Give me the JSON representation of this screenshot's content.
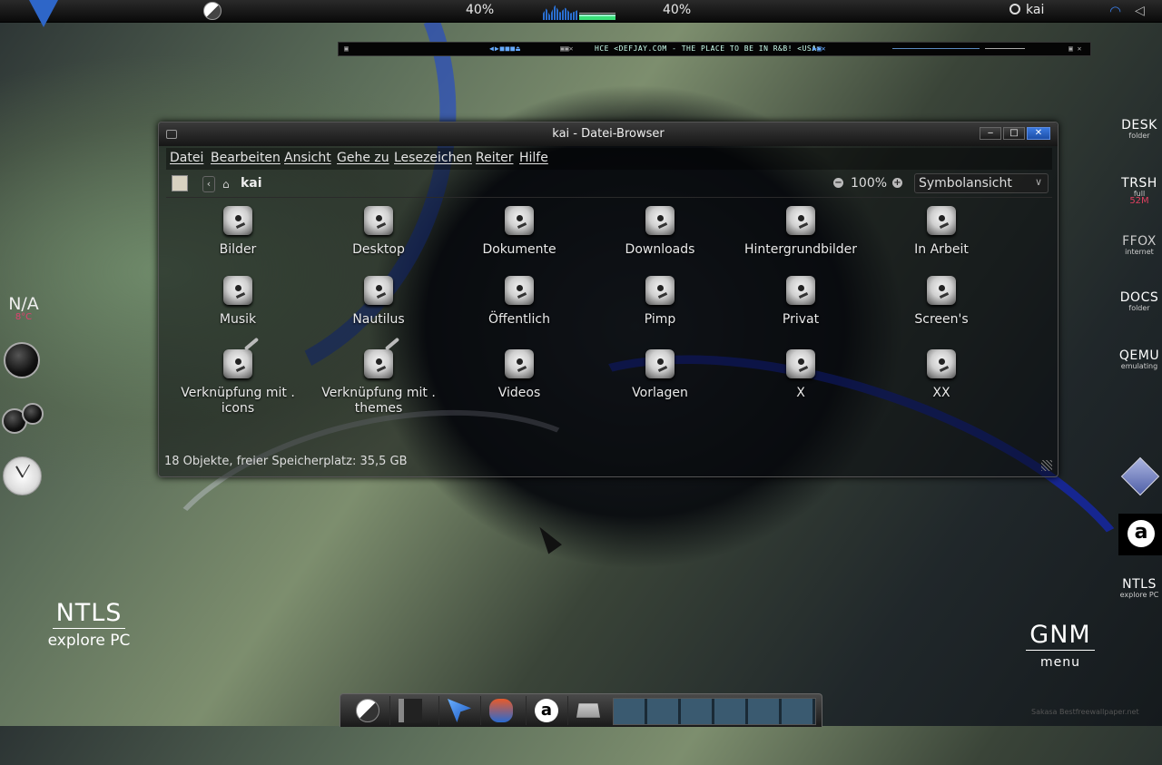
{
  "topbar": {
    "left_percent": "40%",
    "right_percent": "40%",
    "user": "kai"
  },
  "media_player": {
    "title": "HCE <DEFJAY.COM - THE PLACE TO BE IN R&B! <USA>"
  },
  "window": {
    "title": "kai - Datei-Browser",
    "menu": [
      "Datei",
      "Bearbeiten",
      "Ansicht",
      "Gehe zu",
      "Lesezeichen",
      "Reiter",
      "Hilfe"
    ],
    "location": "kai",
    "zoom": "100%",
    "view_mode": "Symbolansicht",
    "items": [
      {
        "label": "Bilder",
        "link": false
      },
      {
        "label": "Desktop",
        "link": false
      },
      {
        "label": "Dokumente",
        "link": false
      },
      {
        "label": "Downloads",
        "link": false
      },
      {
        "label": "Hintergrundbilder",
        "link": false
      },
      {
        "label": "In Arbeit",
        "link": false
      },
      {
        "label": "Musik",
        "link": false
      },
      {
        "label": "Nautilus",
        "link": false
      },
      {
        "label": "Öffentlich",
        "link": false
      },
      {
        "label": "Pimp",
        "link": false
      },
      {
        "label": "Privat",
        "link": false
      },
      {
        "label": "Screen's",
        "link": false
      },
      {
        "label": "Verknüpfung mit .\nicons",
        "link": true
      },
      {
        "label": "Verknüpfung mit .\nthemes",
        "link": true
      },
      {
        "label": "Videos",
        "link": false
      },
      {
        "label": "Vorlagen",
        "link": false
      },
      {
        "label": "X",
        "link": false
      },
      {
        "label": "XX",
        "link": false
      }
    ],
    "status": "18 Objekte, freier Speicherplatz: 35,5 GB"
  },
  "right_dock": [
    {
      "big": "DESK",
      "small": "folder"
    },
    {
      "big": "TRSH",
      "small": "full",
      "extra": "52M"
    },
    {
      "big": "FFOX",
      "small": "internet"
    },
    {
      "big": "DOCS",
      "small": "folder"
    },
    {
      "big": "QEMU",
      "small": "emulating"
    }
  ],
  "right_bottom": {
    "big": "NTLS",
    "small": "explore PC"
  },
  "weather": {
    "condition": "N/A",
    "temp": "8°C"
  },
  "ntls": {
    "big": "NTLS",
    "small": "explore PC"
  },
  "gnm": {
    "big": "GNM",
    "small": "menu"
  },
  "watermark": "Sakasa Bestfreewallpaper.net"
}
